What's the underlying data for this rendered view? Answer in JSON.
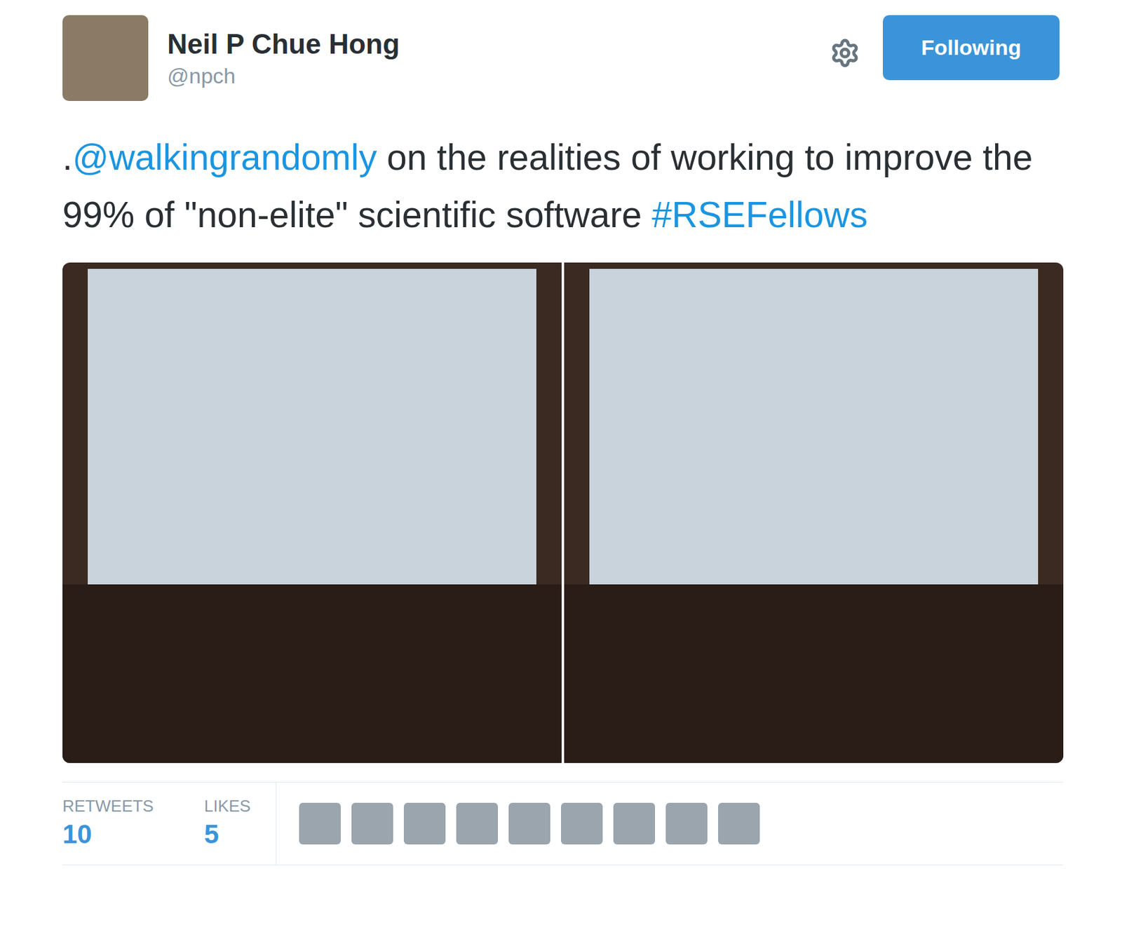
{
  "author": {
    "name": "Neil P Chue Hong",
    "handle": "@npch"
  },
  "follow_button": {
    "label": "Following",
    "selected": true
  },
  "tweet": {
    "segments": [
      {
        "kind": "text",
        "text": "."
      },
      {
        "kind": "mention",
        "text": "@walkingrandomly"
      },
      {
        "kind": "text",
        "text": " on the realities of working to improve the 99% of \"non-elite\" scientific software "
      },
      {
        "kind": "hashtag",
        "text": "#RSEFellows"
      }
    ]
  },
  "media": [
    {
      "kind": "photo"
    },
    {
      "kind": "photo"
    }
  ],
  "stats": [
    {
      "label": "RETWEETS",
      "value": "10"
    },
    {
      "label": "LIKES",
      "value": "5"
    }
  ],
  "likers": [
    {
      "kind": "photo"
    },
    {
      "kind": "photo"
    },
    {
      "kind": "photo"
    },
    {
      "kind": "photo"
    },
    {
      "kind": "photo"
    },
    {
      "kind": "photo"
    },
    {
      "kind": "photo"
    },
    {
      "kind": "photo"
    },
    {
      "kind": "photo"
    }
  ]
}
